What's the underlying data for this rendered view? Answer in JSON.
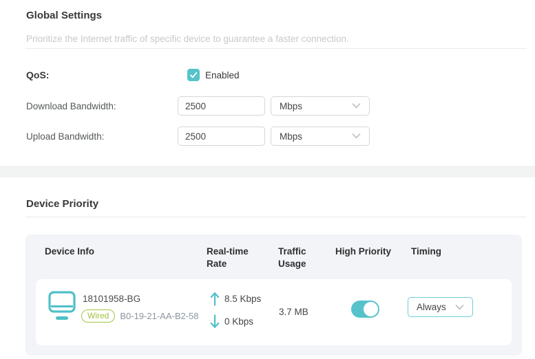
{
  "colors": {
    "accent_teal": "#56c3ca",
    "badge_green": "#9ec13f"
  },
  "global_settings": {
    "title": "Global Settings",
    "subtitle": "Prioritize the Internet traffic of specific device to guarantee a faster connection.",
    "qos": {
      "label": "QoS:",
      "checkbox_label": "Enabled",
      "checked": true
    },
    "download": {
      "label": "Download Bandwidth:",
      "value": "2500",
      "unit": "Mbps"
    },
    "upload": {
      "label": "Upload Bandwidth:",
      "value": "2500",
      "unit": "Mbps"
    }
  },
  "device_priority": {
    "title": "Device Priority",
    "columns": {
      "device_info": "Device Info",
      "realtime_rate": "Real-time Rate",
      "traffic_usage": "Traffic Usage",
      "high_priority": "High Priority",
      "timing": "Timing"
    },
    "rows": [
      {
        "name": "18101958-BG",
        "connection": "Wired",
        "mac": "B0-19-21-AA-B2-58",
        "upload_rate": "8.5 Kbps",
        "download_rate": "0 Kbps",
        "traffic_usage": "3.7 MB",
        "high_priority": true,
        "timing": "Always"
      }
    ]
  }
}
